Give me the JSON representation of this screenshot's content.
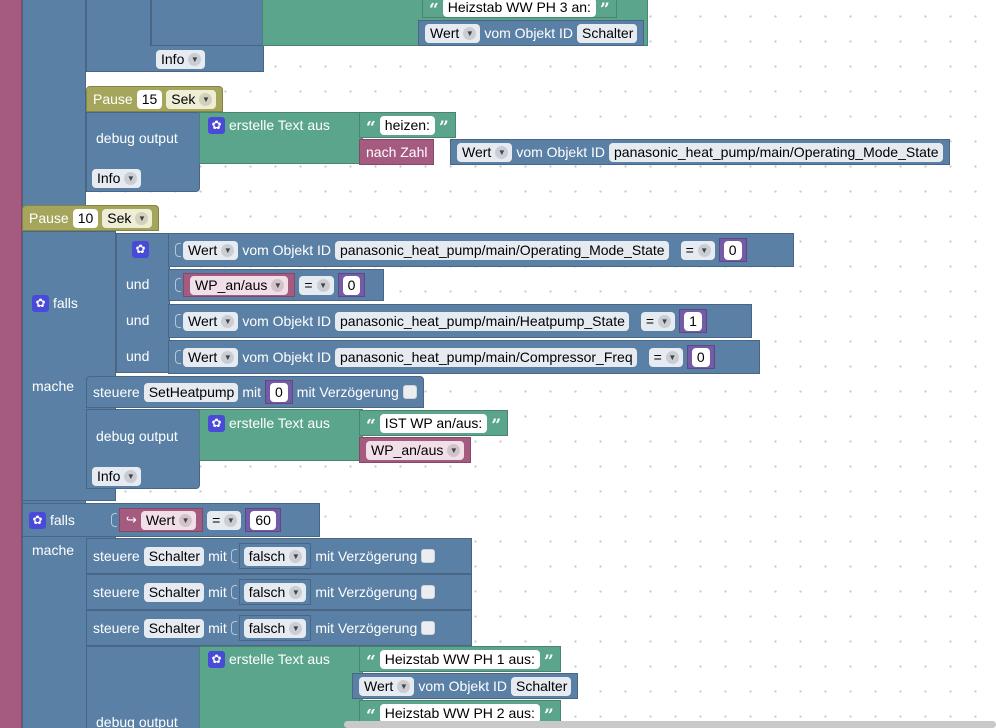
{
  "top": {
    "text1": "Heizstab WW PH 3 an:",
    "wert": "Wert",
    "vom": "vom Objekt ID",
    "obj1": "Schalter",
    "info": "Info"
  },
  "pause1": {
    "label": "Pause",
    "num": "15",
    "unit": "Sek"
  },
  "debug1": {
    "label": "debug output",
    "erstelle": "erstelle Text aus",
    "text": "heizen:",
    "nach_zahl": "nach Zahl",
    "wert": "Wert",
    "vom": "vom Objekt ID",
    "obj": "panasonic_heat_pump/main/Operating_Mode_State",
    "info": "Info"
  },
  "pause2": {
    "label": "Pause",
    "num": "10",
    "unit": "Sek"
  },
  "if1": {
    "falls": "falls",
    "mache": "mache",
    "und": "und",
    "c1": {
      "wert": "Wert",
      "vom": "vom Objekt ID",
      "obj": "panasonic_heat_pump/main/Operating_Mode_State",
      "op": "=",
      "val": "0"
    },
    "c2": {
      "var": "WP_an/aus",
      "op": "=",
      "val": "0"
    },
    "c3": {
      "wert": "Wert",
      "vom": "vom Objekt ID",
      "obj": "panasonic_heat_pump/main/Heatpump_State",
      "op": "=",
      "val": "1"
    },
    "c4": {
      "wert": "Wert",
      "vom": "vom Objekt ID",
      "obj": "panasonic_heat_pump/main/Compressor_Freq",
      "op": "=",
      "val": "0"
    },
    "steuere": {
      "label": "steuere",
      "obj": "SetHeatpump",
      "mit": "mit",
      "val": "0",
      "delay": "mit Verzögerung"
    },
    "debug": {
      "label": "debug output",
      "erstelle": "erstelle Text aus",
      "text": "IST WP an/aus:",
      "var": "WP_an/aus",
      "info": "Info"
    }
  },
  "if2": {
    "falls": "falls",
    "mache": "mache",
    "cond": {
      "var": "Wert",
      "op": "=",
      "val": "60"
    },
    "rows": [
      {
        "label": "steuere",
        "obj": "Schalter",
        "mit": "mit",
        "val": "falsch",
        "delay": "mit Verzögerung"
      },
      {
        "label": "steuere",
        "obj": "Schalter",
        "mit": "mit",
        "val": "falsch",
        "delay": "mit Verzögerung"
      },
      {
        "label": "steuere",
        "obj": "Schalter",
        "mit": "mit",
        "val": "falsch",
        "delay": "mit Verzögerung"
      }
    ],
    "debug": {
      "label": "debug output",
      "erstelle": "erstelle Text aus",
      "text1": "Heizstab WW PH 1 aus:",
      "wert": "Wert",
      "vom": "vom Objekt ID",
      "obj": "Schalter",
      "text2": "Heizstab WW PH 2 aus:"
    }
  },
  "colors": {
    "control": "#5b80a5",
    "text": "#5ba58c",
    "pause": "#a5a55b",
    "variable": "#a55b80",
    "math": "#745ba5",
    "gear": "#4a4ad8"
  }
}
